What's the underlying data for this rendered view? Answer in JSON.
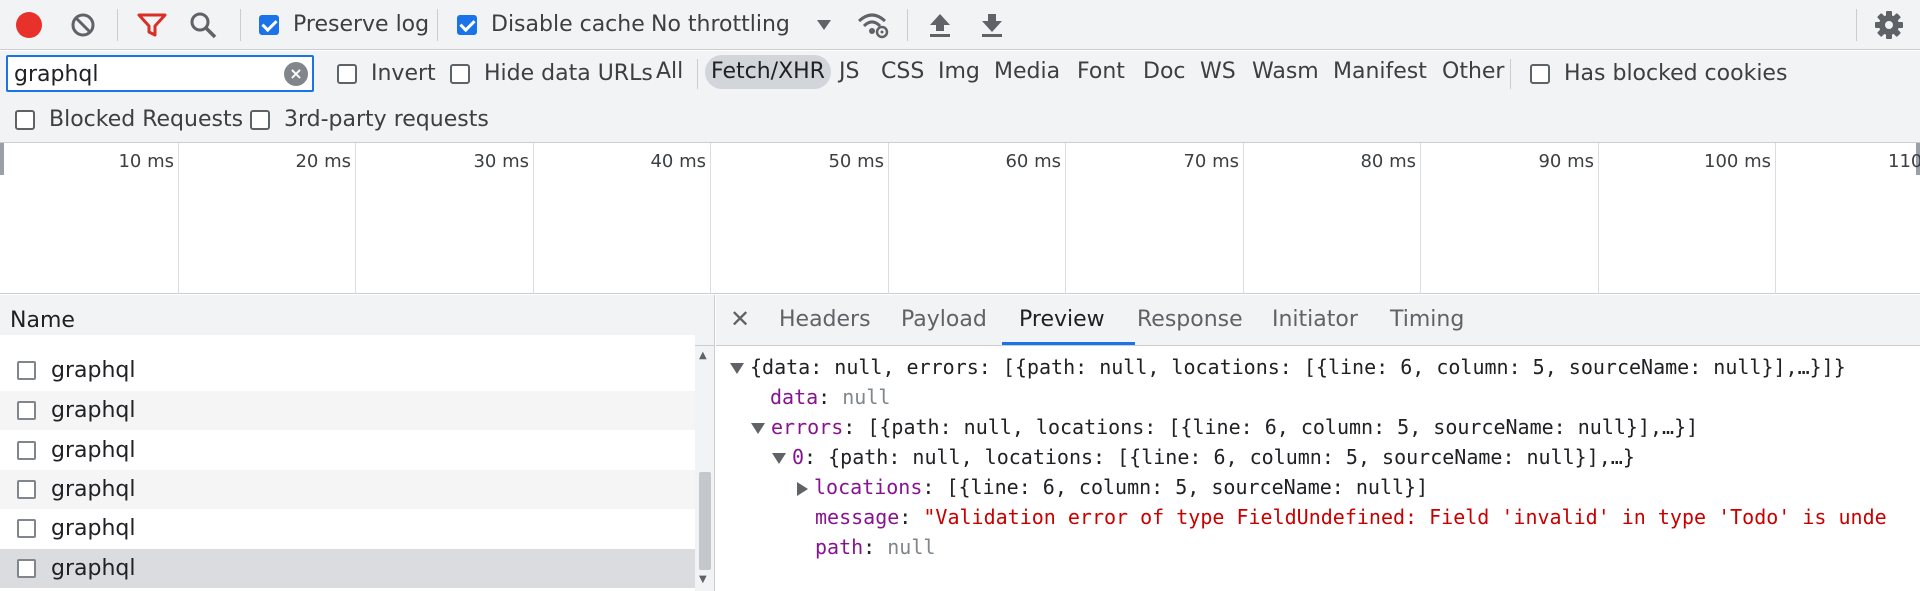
{
  "toolbar": {
    "preserve_log_label": "Preserve log",
    "preserve_log_checked": true,
    "disable_cache_label": "Disable cache",
    "disable_cache_checked": true,
    "throttling_value": "No throttling",
    "record_color": "#e8312a",
    "filter_icon_color": "#d93025"
  },
  "filter": {
    "search_value": "graphql",
    "invert_label": "Invert",
    "hide_data_urls_label": "Hide data URLs",
    "types": [
      "All",
      "Fetch/XHR",
      "JS",
      "CSS",
      "Img",
      "Media",
      "Font",
      "Doc",
      "WS",
      "Wasm",
      "Manifest",
      "Other"
    ],
    "active_type": "Fetch/XHR",
    "has_blocked_cookies_label": "Has blocked cookies",
    "blocked_requests_label": "Blocked Requests",
    "third_party_label": "3rd-party requests"
  },
  "overview": {
    "ticks": [
      "10 ms",
      "20 ms",
      "30 ms",
      "40 ms",
      "50 ms",
      "60 ms",
      "70 ms",
      "80 ms",
      "90 ms",
      "100 ms",
      "110"
    ]
  },
  "requests": {
    "column_name": "Name",
    "rows": [
      "graphql",
      "graphql",
      "graphql",
      "graphql",
      "graphql",
      "graphql"
    ]
  },
  "details": {
    "tabs": [
      "Headers",
      "Payload",
      "Preview",
      "Response",
      "Initiator",
      "Timing"
    ],
    "active_tab": "Preview",
    "preview": {
      "root_summary": "{data: null, errors: [{path: null, locations: [{line: 6, column: 5, sourceName: null}],…}]}",
      "data_key": "data",
      "data_value": "null",
      "errors_key": "errors",
      "errors_summary": "[{path: null, locations: [{line: 6, column: 5, sourceName: null}],…}]",
      "item_key": "0",
      "item_summary": "{path: null, locations: [{line: 6, column: 5, sourceName: null}],…}",
      "locations_key": "locations",
      "locations_summary": "[{line: 6, column: 5, sourceName: null}]",
      "message_key": "message",
      "message_value": "\"Validation error of type FieldUndefined: Field 'invalid' in type 'Todo' is unde",
      "path_key": "path",
      "path_value": "null"
    }
  }
}
